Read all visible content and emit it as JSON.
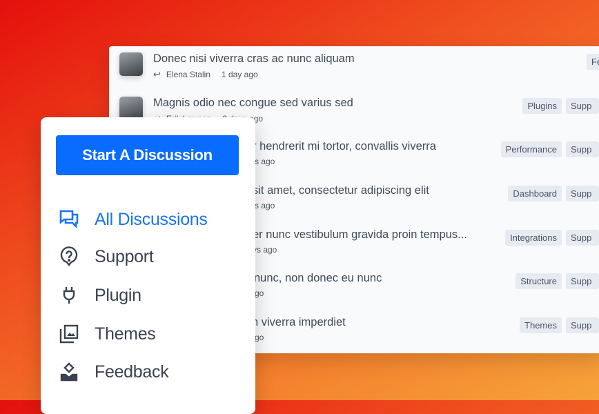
{
  "discussions": [
    {
      "title": "Donec nisi viverra cras ac nunc aliquam",
      "author": "Elena Stalin",
      "time": "1 day ago",
      "tags": [
        "Feedba"
      ]
    },
    {
      "title": "Magnis odio nec congue sed varius sed",
      "author": "Erik Lawson",
      "time": "2 days ago",
      "tags": [
        "Plugins",
        "Supp"
      ]
    },
    {
      "title": "r hendrerit mi tortor, convallis viverra",
      "time": "s ago",
      "tags": [
        "Performance",
        "Supp"
      ]
    },
    {
      "title": "sit amet, consectetur adipiscing elit",
      "time": "s ago",
      "tags": [
        "Dashboard",
        "Supp"
      ]
    },
    {
      "title": "er nunc vestibulum gravida proin tempus...",
      "time": "ys ago",
      "tags": [
        "Integrations",
        "Supp"
      ]
    },
    {
      "title": "nunc, non donec eu nunc",
      "time": "go",
      "tags": [
        "Structure",
        "Supp"
      ]
    },
    {
      "title": "n viverra imperdiet",
      "time": "go",
      "tags": [
        "Themes",
        "Supp"
      ]
    }
  ],
  "sidebar": {
    "start_button": "Start A Discussion",
    "items": [
      {
        "label": "All Discussions",
        "icon": "chat-icon",
        "active": true
      },
      {
        "label": "Support",
        "icon": "question-bubble-icon"
      },
      {
        "label": "Plugin",
        "icon": "plug-icon"
      },
      {
        "label": "Themes",
        "icon": "images-icon"
      },
      {
        "label": "Feedback",
        "icon": "feedback-icon"
      }
    ]
  },
  "colors": {
    "accent": "#0a6cff",
    "active": "#1a73f0"
  }
}
